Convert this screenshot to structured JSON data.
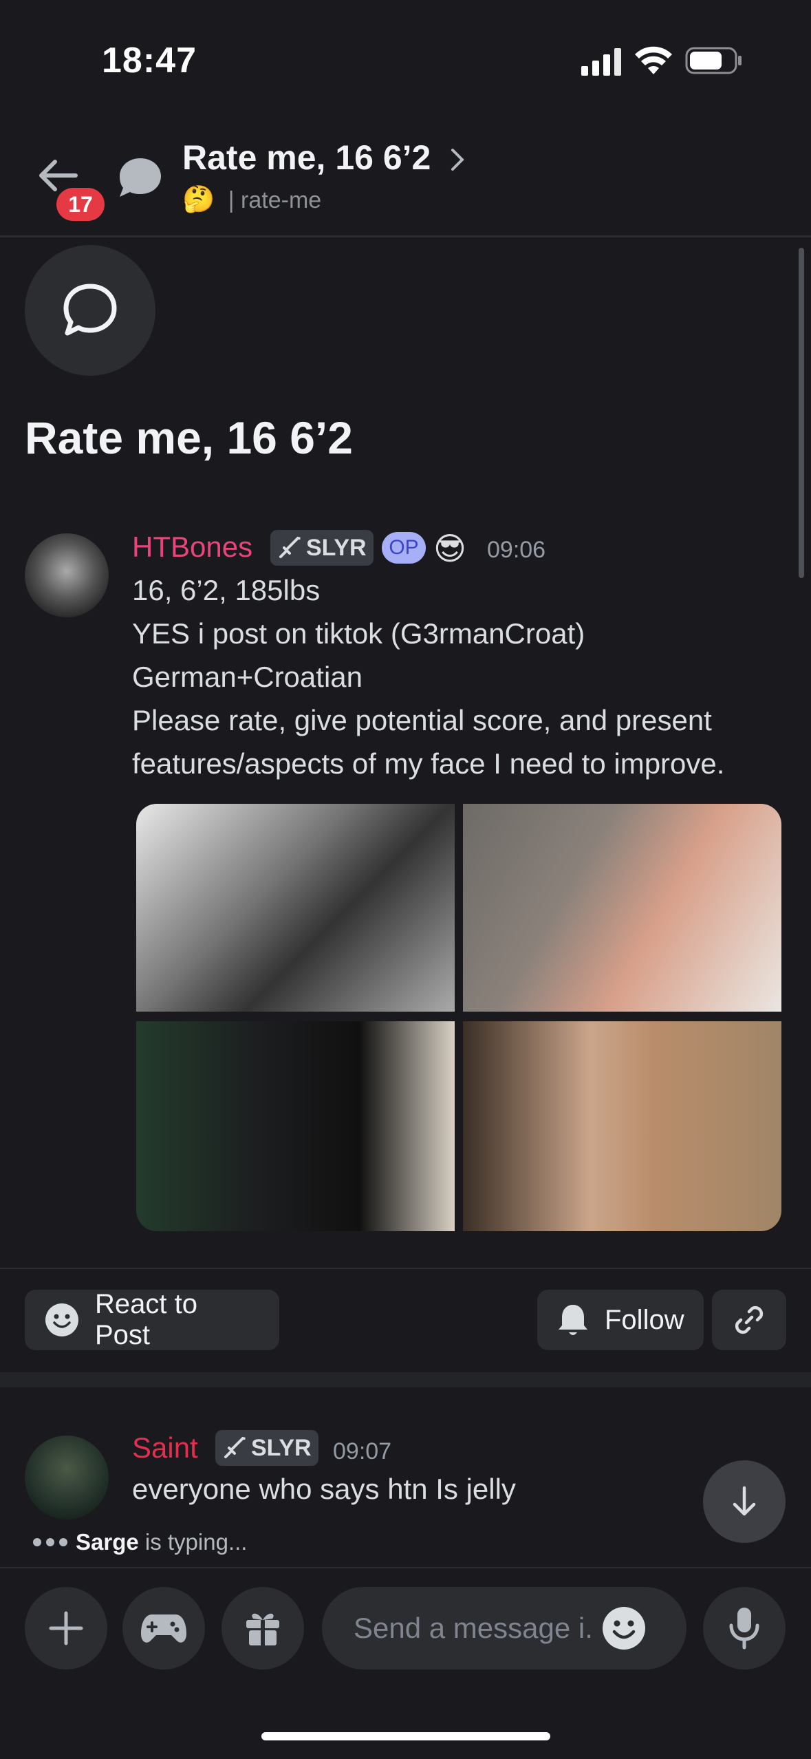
{
  "status_bar": {
    "time": "18:47"
  },
  "header": {
    "unread_badge": "17",
    "title": "Rate me, 16 6’2",
    "emoji": "🤔",
    "channel": "| rate-me"
  },
  "post": {
    "title": "Rate me, 16 6’2",
    "author": "HTBones",
    "tag": "SLYR",
    "op_badge": "OP",
    "author_emoji": "😎",
    "time": "09:06",
    "lines": [
      "16, 6’2, 185lbs",
      "YES i post on tiktok (G3rmanCroat)",
      "German+Croatian",
      "Please rate, give potential score, and present",
      "features/aspects of my face I need to improve."
    ]
  },
  "actions": {
    "react_label": "React to Post",
    "follow_label": "Follow"
  },
  "reply": {
    "author": "Saint",
    "tag": "SLYR",
    "time": "09:07",
    "text": "everyone who says htn Is jelly"
  },
  "typing": {
    "user": "Sarge",
    "suffix": " is typing..."
  },
  "composer": {
    "placeholder": "Send a message i.."
  },
  "colors": {
    "op_name": "#e8457a",
    "reply_name": "#e0304f",
    "badge": "#e53a44"
  }
}
